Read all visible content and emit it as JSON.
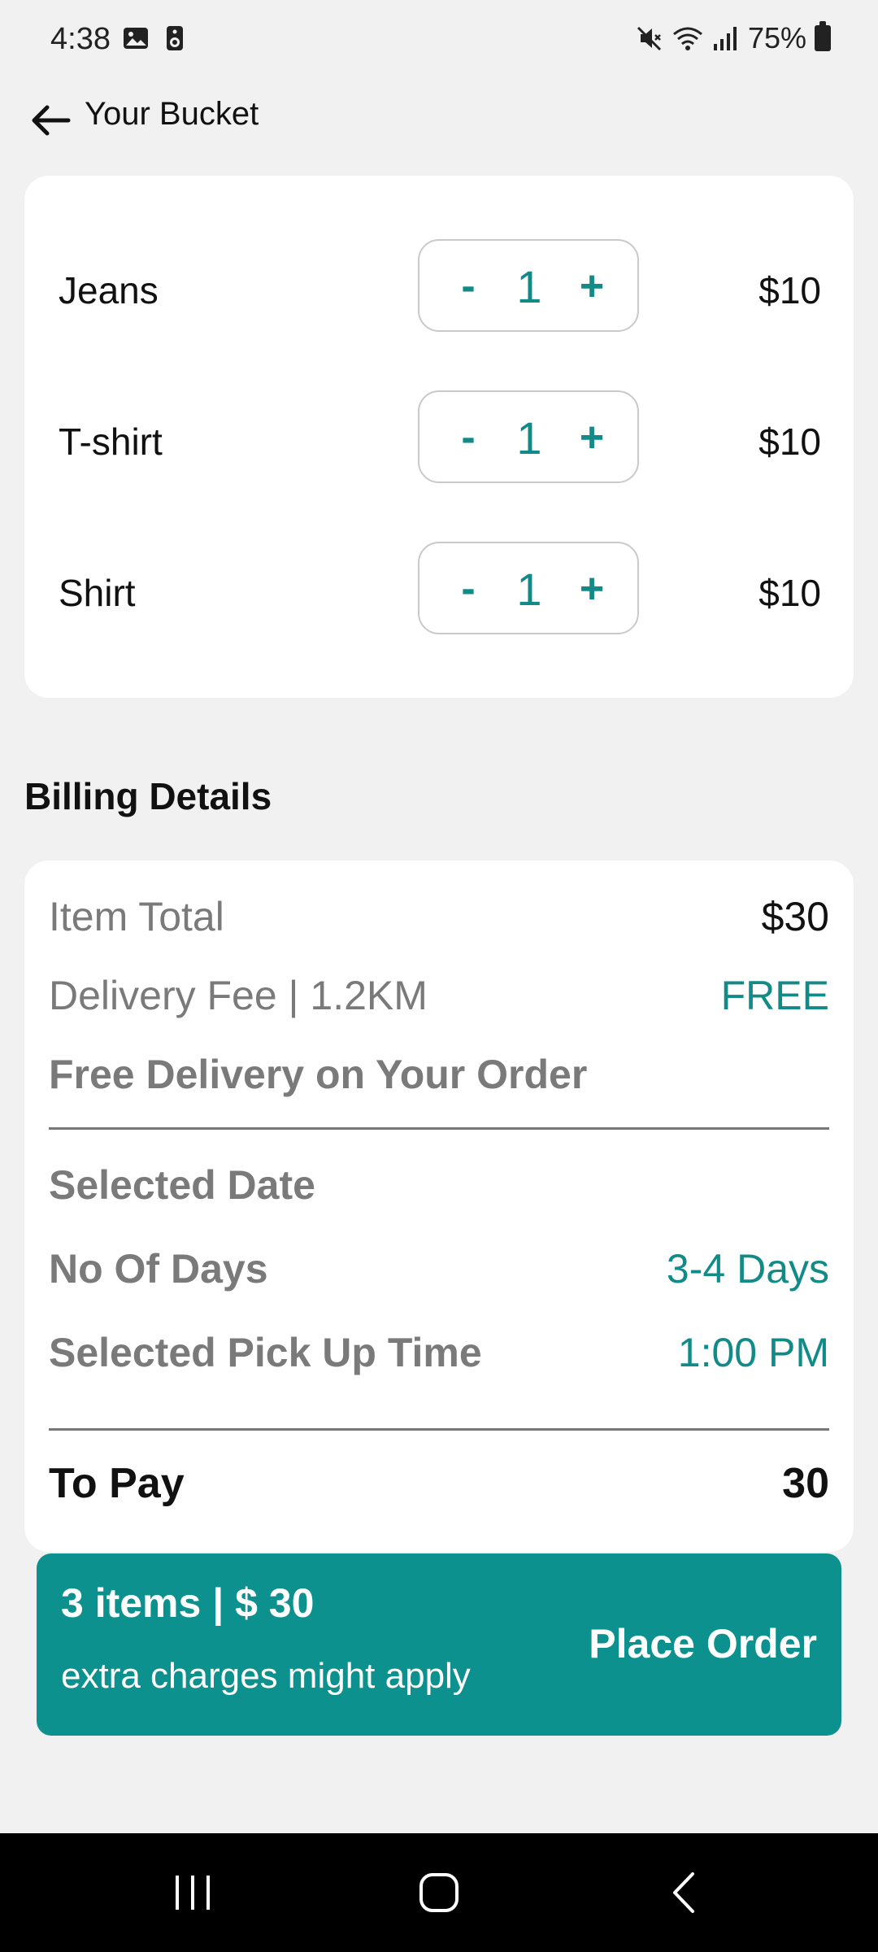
{
  "status_bar": {
    "time": "4:38",
    "battery": "75%",
    "icons": [
      "gallery-icon",
      "speaker-icon",
      "mute-icon",
      "wifi-icon",
      "signal-icon",
      "battery-icon"
    ]
  },
  "header": {
    "title": "Your Bucket"
  },
  "items": [
    {
      "name": "Jeans",
      "minus": "-",
      "qty": "1",
      "plus": "+",
      "price": "$10"
    },
    {
      "name": "T-shirt",
      "minus": "-",
      "qty": "1",
      "plus": "+",
      "price": "$10"
    },
    {
      "name": "Shirt",
      "minus": "-",
      "qty": "1",
      "plus": "+",
      "price": "$10"
    }
  ],
  "billing": {
    "heading": "Billing Details",
    "item_total_label": "Item Total",
    "item_total_value": "$30",
    "delivery_fee_label": "Delivery Fee | 1.2KM",
    "delivery_fee_value": "FREE",
    "free_delivery_note": "Free Delivery on Your Order",
    "selected_date_label": "Selected Date",
    "no_of_days_label": "No Of Days",
    "no_of_days_value": "3-4 Days",
    "pickup_time_label": "Selected Pick Up Time",
    "pickup_time_value": "1:00 PM",
    "to_pay_label": "To Pay",
    "to_pay_value": "30"
  },
  "order_bar": {
    "summary": "3 items | $ 30",
    "note": "extra charges might apply",
    "button": "Place Order"
  },
  "colors": {
    "accent": "#128b88",
    "order_bar": "#0c918e",
    "background": "#f1f1f1"
  }
}
